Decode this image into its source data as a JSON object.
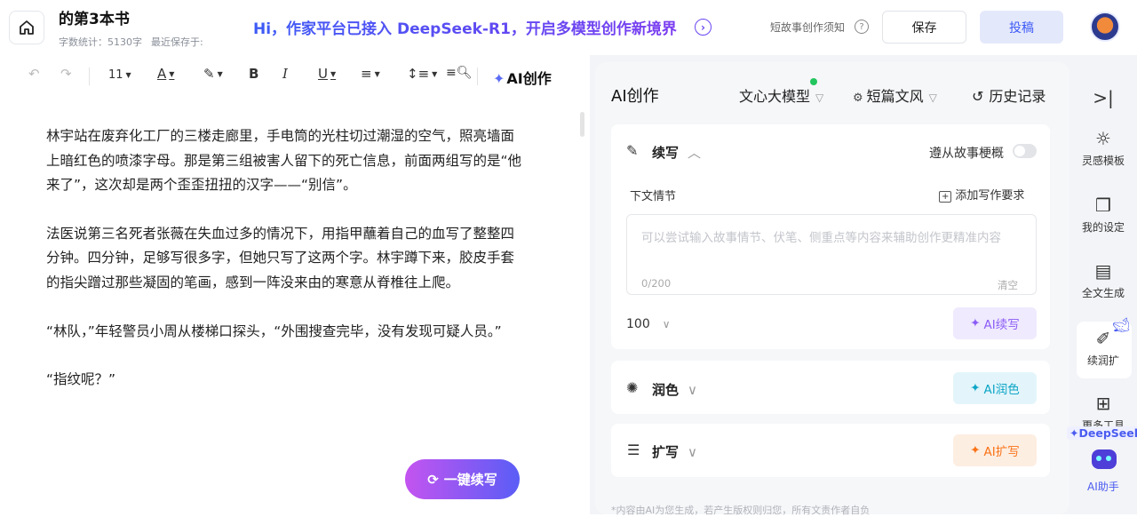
{
  "header": {
    "book_title": "的第3本书",
    "word_count": "字数统计：5130字",
    "last_saved": "最近保存于:",
    "banner": "Hi，作家平台已接入 DeepSeek-R1，开启多模型创作新境界",
    "notice": "短故事创作须知",
    "save_label": "保存",
    "submit_label": "投稿"
  },
  "toolbar": {
    "font_size": "11",
    "ai_create": "AI创作"
  },
  "editor": {
    "paragraphs": [
      "林宇站在废弃化工厂的三楼走廊里，手电筒的光柱切过潮湿的空气，照亮墙面上暗红色的喷漆字母。那是第三组被害人留下的死亡信息，前面两组写的是“他来了”，这次却是两个歪歪扭扭的汉字——“别信”。",
      "法医说第三名死者张薇在失血过多的情况下，用指甲蘸着自己的血写了整整四分钟。四分钟，足够写很多字，但她只写了这两个字。林宇蹲下来，胶皮手套的指尖蹭过那些凝固的笔画，感到一阵没来由的寒意从脊椎往上爬。",
      "“林队，”年轻警员小周从楼梯口探头，“外围搜查完毕，没有发现可疑人员。”",
      "“指纹呢？”"
    ],
    "one_click": "一键续写"
  },
  "panel": {
    "title": "AI创作",
    "model": "文心大模型",
    "style": "短篇文风",
    "history": "历史记录",
    "continue": {
      "title": "续写",
      "follow_outline": "遵从故事梗概",
      "next_plot": "下文情节",
      "add_requirement": "添加写作要求",
      "placeholder": "可以尝试输入故事情节、伏笔、侧重点等内容来辅助创作更精准内容",
      "counter": "0/200",
      "clear": "清空",
      "length": "100",
      "button": "AI续写"
    },
    "polish": {
      "title": "润色",
      "button": "AI润色"
    },
    "expand": {
      "title": "扩写",
      "button": "AI扩写"
    },
    "footnote": "*内容由AI为您生成，若产生版权则归您，所有文责作者自负"
  },
  "rail": {
    "items": [
      "灵感模板",
      "我的设定",
      "全文生成",
      "续润扩",
      "更多工具"
    ],
    "deepseek": "DeepSeek",
    "assistant": "AI助手"
  },
  "colors": {
    "accent": "#3d5bf5",
    "purple": "#8b5cf6",
    "cyan": "#0ea5c6",
    "orange": "#f97316"
  }
}
